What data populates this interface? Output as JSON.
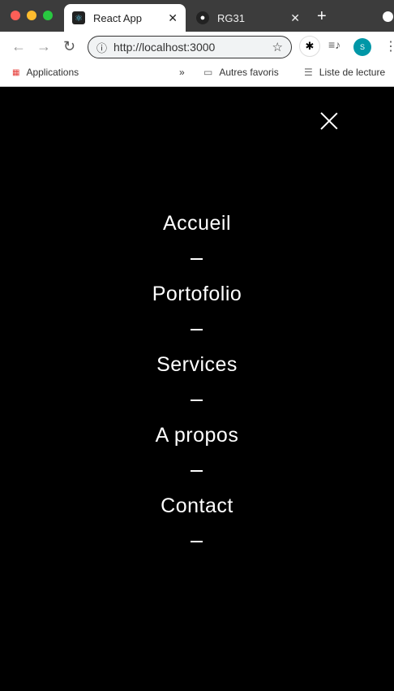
{
  "browser": {
    "tabs": [
      {
        "title": "React App",
        "icon": "react-icon",
        "active": true
      },
      {
        "title": "RG31",
        "icon": "github-icon",
        "active": false
      }
    ],
    "new_tab": "+",
    "url": "http://localhost:3000",
    "profile_initial": "S",
    "bookmarks": {
      "apps": "Applications",
      "more": "»",
      "other": "Autres favoris",
      "reading_list": "Liste de lecture"
    }
  },
  "menu": {
    "items": [
      {
        "label": "Accueil"
      },
      {
        "label": "Portofolio"
      },
      {
        "label": "Services"
      },
      {
        "label": "A propos"
      },
      {
        "label": "Contact"
      }
    ]
  }
}
